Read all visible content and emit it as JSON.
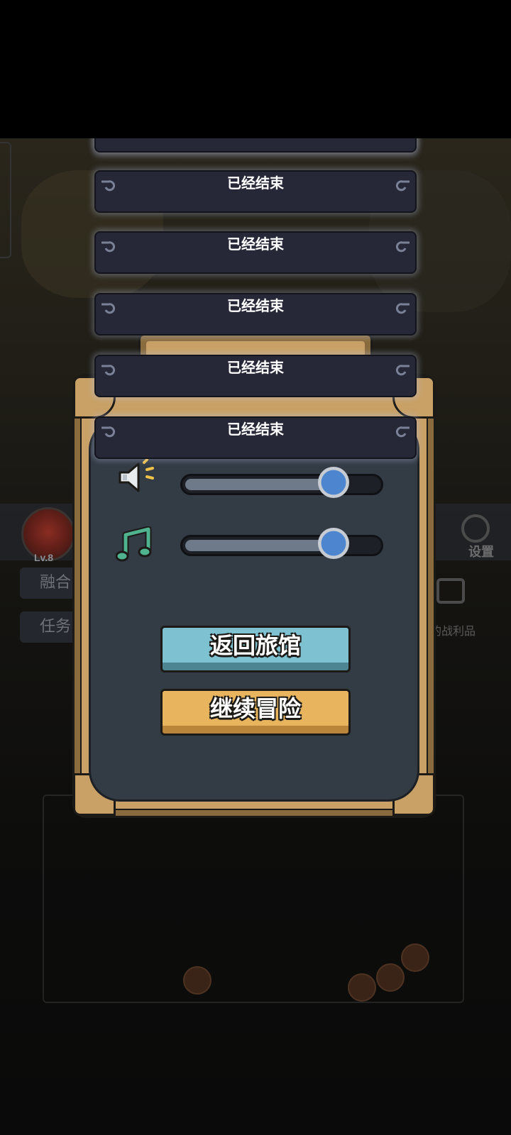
{
  "background": {
    "player_level": "Lv.8",
    "side_buttons": [
      "融合",
      "任务"
    ],
    "settings_label": "设置",
    "loot_label": "的战利品"
  },
  "banners": [
    {
      "text": ""
    },
    {
      "text": "已经结束"
    },
    {
      "text": "已经结束"
    },
    {
      "text": "已经结束"
    },
    {
      "text": "已经结束"
    },
    {
      "text": "已经结束"
    }
  ],
  "settings_panel": {
    "sound_icon": "speaker-icon",
    "music_icon": "music-note-icon",
    "sound_volume": 0.77,
    "music_volume": 0.77,
    "return_button": "返回旅馆",
    "continue_button": "继续冒险",
    "colors": {
      "accent_blue": "#4d86cf",
      "return_button": "#7ec1d1",
      "continue_button": "#e8b45e",
      "frame_gold": "#c9a166",
      "panel": "#333b45",
      "music_icon": "#4fb38f"
    }
  }
}
